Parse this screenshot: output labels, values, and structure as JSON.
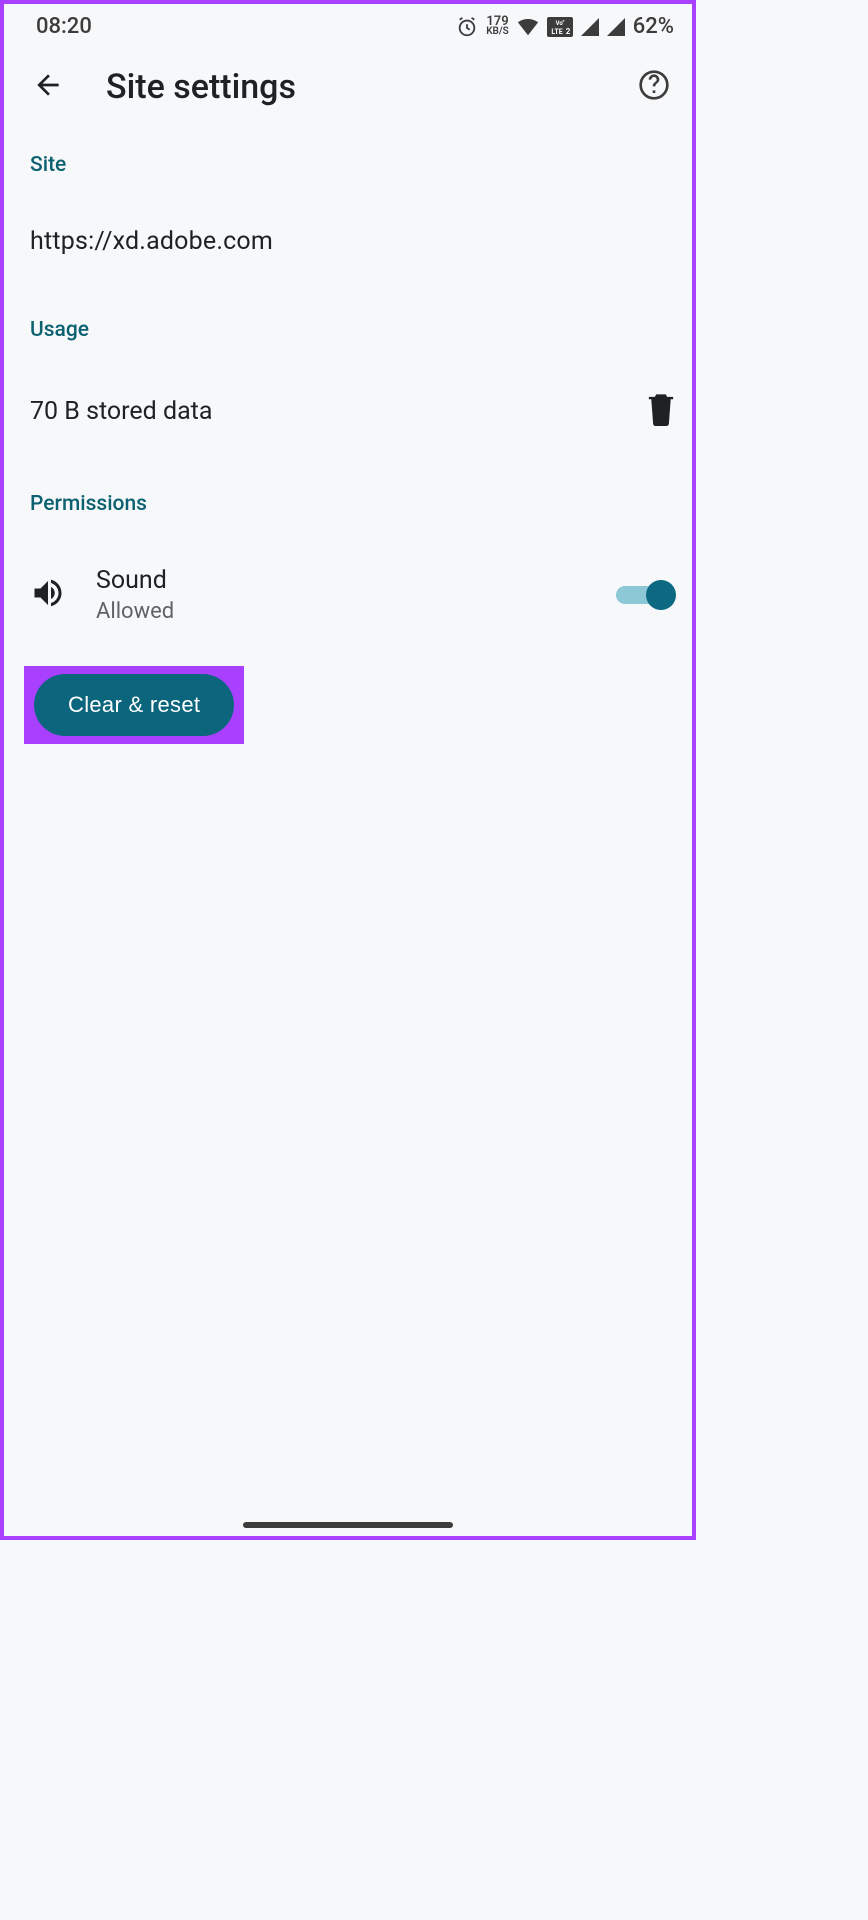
{
  "status": {
    "time": "08:20",
    "speed_top": "179",
    "speed_bot": "KB/S",
    "volte_label": "Vo\" LTE 2",
    "battery_pct": "62%"
  },
  "header": {
    "title": "Site settings"
  },
  "sections": {
    "site_label": "Site",
    "site_url": "https://xd.adobe.com",
    "usage_label": "Usage",
    "usage_value": "70 B stored data",
    "permissions_label": "Permissions"
  },
  "permissions": [
    {
      "title": "Sound",
      "subtitle": "Allowed",
      "icon": "volume-icon",
      "toggled": true
    }
  ],
  "actions": {
    "clear_reset_label": "Clear & reset"
  },
  "colors": {
    "accent": "#0b657d",
    "accent_text": "#0b6170",
    "highlight": "#a940ff"
  }
}
